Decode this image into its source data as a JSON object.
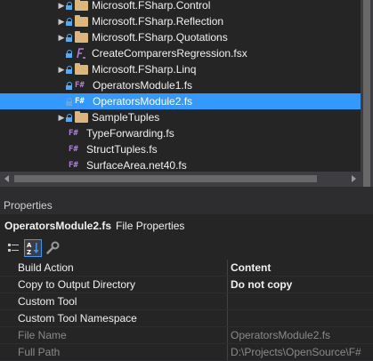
{
  "solution_explorer": {
    "items": [
      {
        "label": "Microsoft.FSharp.Control",
        "kind": "folder",
        "expandable": true,
        "locked": true,
        "selected": false
      },
      {
        "label": "Microsoft.FSharp.Reflection",
        "kind": "folder",
        "expandable": true,
        "locked": true,
        "selected": false
      },
      {
        "label": "Microsoft.FSharp.Quotations",
        "kind": "folder",
        "expandable": true,
        "locked": true,
        "selected": false
      },
      {
        "label": "CreateComparersRegression.fsx",
        "kind": "fsx",
        "expandable": false,
        "locked": true,
        "selected": false
      },
      {
        "label": "Microsoft.FSharp.Linq",
        "kind": "folder",
        "expandable": true,
        "locked": true,
        "selected": false
      },
      {
        "label": "OperatorsModule1.fs",
        "kind": "fs",
        "expandable": false,
        "locked": true,
        "selected": false
      },
      {
        "label": "OperatorsModule2.fs",
        "kind": "fs",
        "expandable": false,
        "locked": true,
        "selected": true
      },
      {
        "label": "SampleTuples",
        "kind": "folder",
        "expandable": true,
        "locked": true,
        "selected": false
      },
      {
        "label": "TypeForwarding.fs",
        "kind": "fs",
        "expandable": false,
        "locked": false,
        "selected": false
      },
      {
        "label": "StructTuples.fs",
        "kind": "fs",
        "expandable": false,
        "locked": false,
        "selected": false
      },
      {
        "label": "SurfaceArea.net40.fs",
        "kind": "fs",
        "expandable": false,
        "locked": false,
        "selected": false
      }
    ],
    "fs_icon_text": "F#"
  },
  "properties": {
    "title": "Properties",
    "object_name": "OperatorsModule2.fs",
    "object_type": "File Properties",
    "rows": [
      {
        "name": "Build Action",
        "value": "Content",
        "bold": true,
        "readonly": false
      },
      {
        "name": "Copy to Output Directory",
        "value": "Do not copy",
        "bold": true,
        "readonly": false
      },
      {
        "name": "Custom Tool",
        "value": "",
        "bold": false,
        "readonly": false
      },
      {
        "name": "Custom Tool Namespace",
        "value": "",
        "bold": false,
        "readonly": false
      },
      {
        "name": "File Name",
        "value": "OperatorsModule2.fs",
        "bold": false,
        "readonly": true
      },
      {
        "name": "Full Path",
        "value": "D:\\Projects\\OpenSource\\F#",
        "bold": false,
        "readonly": true
      }
    ]
  },
  "colors": {
    "background": "#252526",
    "selection": "#3399ff",
    "folder": "#dcb67a",
    "fsharp": "#b180d7",
    "lock": "#5fa8e8"
  }
}
